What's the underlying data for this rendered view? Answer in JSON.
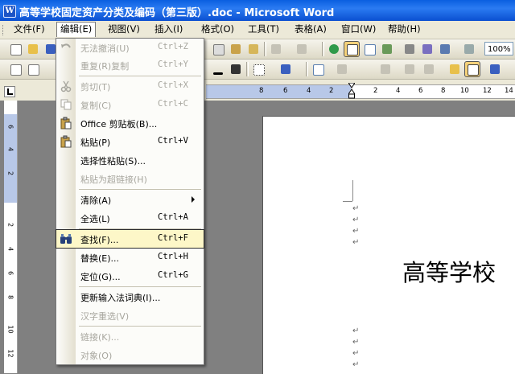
{
  "window": {
    "title": "高等学校固定资产分类及编码（第三版）.doc - Microsoft Word"
  },
  "menubar": {
    "items": [
      {
        "label": "文件(F)"
      },
      {
        "label": "编辑(E)"
      },
      {
        "label": "视图(V)"
      },
      {
        "label": "插入(I)"
      },
      {
        "label": "格式(O)"
      },
      {
        "label": "工具(T)"
      },
      {
        "label": "表格(A)"
      },
      {
        "label": "窗口(W)"
      },
      {
        "label": "帮助(H)"
      }
    ]
  },
  "toolbar": {
    "zoom": "100%"
  },
  "ruler": {
    "h_ticks": [
      "8",
      "6",
      "4",
      "2",
      "2",
      "4",
      "6",
      "8",
      "10",
      "12",
      "14"
    ],
    "v_ticks": [
      "6",
      "4",
      "2",
      "2",
      "4",
      "6",
      "8",
      "10",
      "12"
    ]
  },
  "edit_menu": {
    "items": [
      {
        "label": "无法撤消(U)",
        "shortcut": "Ctrl+Z"
      },
      {
        "label": "重复(R)复制",
        "shortcut": "Ctrl+Y"
      },
      {
        "label": "剪切(T)",
        "shortcut": "Ctrl+X"
      },
      {
        "label": "复制(C)",
        "shortcut": "Ctrl+C"
      },
      {
        "label": "Office 剪贴板(B)...",
        "shortcut": ""
      },
      {
        "label": "粘贴(P)",
        "shortcut": "Ctrl+V"
      },
      {
        "label": "选择性粘贴(S)...",
        "shortcut": ""
      },
      {
        "label": "粘贴为超链接(H)",
        "shortcut": ""
      },
      {
        "label": "清除(A)",
        "shortcut": ""
      },
      {
        "label": "全选(L)",
        "shortcut": "Ctrl+A"
      },
      {
        "label": "查找(F)...",
        "shortcut": "Ctrl+F"
      },
      {
        "label": "替换(E)...",
        "shortcut": "Ctrl+H"
      },
      {
        "label": "定位(G)...",
        "shortcut": "Ctrl+G"
      },
      {
        "label": "更新输入法词典(I)...",
        "shortcut": ""
      },
      {
        "label": "汉字重选(V)",
        "shortcut": ""
      },
      {
        "label": "链接(K)...",
        "shortcut": ""
      },
      {
        "label": "对象(O)",
        "shortcut": ""
      }
    ]
  },
  "document": {
    "heading": "高等学校",
    "paragraph_mark": "↵"
  },
  "colors": {
    "title_bar": "#0a5fe0",
    "menu_bg": "#ece9d8",
    "highlight": "#fdf7c8",
    "disabled": "#a7a69e"
  }
}
